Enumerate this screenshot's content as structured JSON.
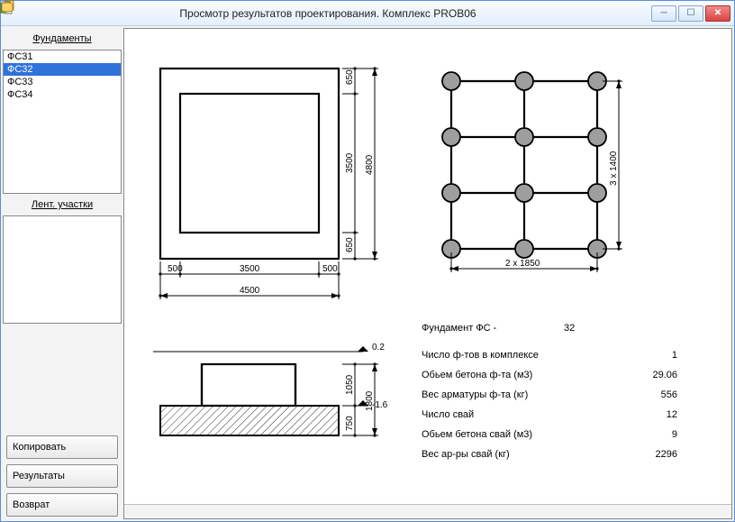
{
  "window": {
    "title": "Просмотр результатов проектирования. Комплекс PROB06"
  },
  "sidebar": {
    "panel1_title": "Фундаменты",
    "panel2_title": "Лент. участки",
    "items": [
      {
        "label": "ФС31",
        "selected": false
      },
      {
        "label": "ФС32",
        "selected": true
      },
      {
        "label": "ФС33",
        "selected": false
      },
      {
        "label": "ФС34",
        "selected": false
      }
    ],
    "btn_copy": "Копировать",
    "btn_results": "Результаты",
    "btn_return": "Возврат"
  },
  "drawing": {
    "plan": {
      "w_outer": "4500",
      "w_inner": "3500",
      "w_margin_l": "500",
      "w_margin_r": "500",
      "h_outer": "4800",
      "h_inner": "3500",
      "h_margin_t": "650",
      "h_margin_b": "650"
    },
    "piles": {
      "note_x": "2  x  1850",
      "note_y": "3  x  1400"
    },
    "section": {
      "top_mark": "0.2",
      "bot_mark": "-1.6",
      "h_total": "1800",
      "h_step": "1050",
      "h_base": "750"
    },
    "info": {
      "title_l": "Фундамент   ФС -",
      "title_v": "32",
      "rows": [
        {
          "l": "Число ф-тов в комплексе",
          "v": "1"
        },
        {
          "l": "Обьем бетона ф-та (м3)",
          "v": "29.06"
        },
        {
          "l": "Вес арматуры ф-та (кг)",
          "v": "556"
        },
        {
          "l": "Число свай",
          "v": "12"
        },
        {
          "l": "Обьем бетона свай (м3)",
          "v": "9"
        },
        {
          "l": "Вес ар-ры свай (кг)",
          "v": "2296"
        }
      ]
    }
  }
}
